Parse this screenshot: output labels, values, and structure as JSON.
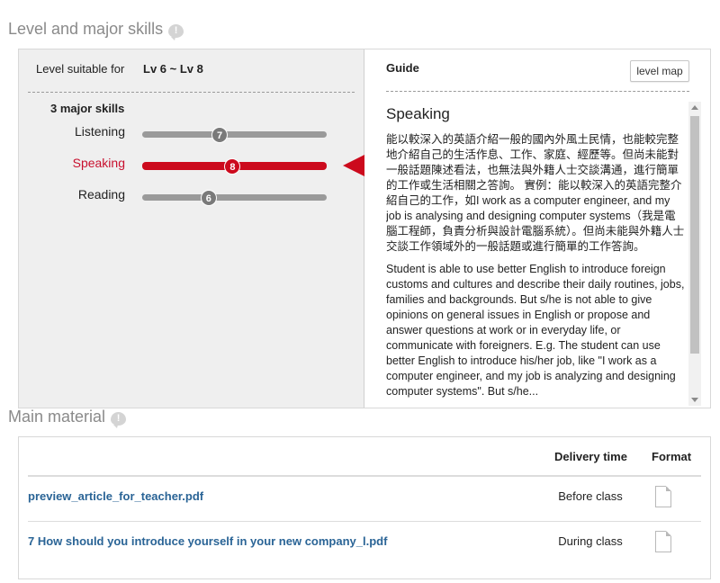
{
  "level_section": {
    "title": "Level and major skills",
    "help_icon": "!",
    "level_label": "Level suitable for",
    "level_value": "Lv 6 ~ Lv 8",
    "skills_title": "3 major skills",
    "skills": [
      {
        "label": "Listening",
        "level": "7",
        "fraction": 0.42,
        "active": false
      },
      {
        "label": "Speaking",
        "level": "8",
        "fraction": 0.49,
        "active": true
      },
      {
        "label": "Reading",
        "level": "6",
        "fraction": 0.36,
        "active": false
      }
    ],
    "accent_color": "#cc0a1d"
  },
  "guide": {
    "title": "Guide",
    "level_map_button": "level map",
    "heading": "Speaking",
    "paragraph_zh": "能以較深入的英語介紹一般的國內外風土民情，也能較完整地介紹自己的生活作息、工作、家庭、經歷等。但尚未能對一般話題陳述看法，也無法與外籍人士交談溝通，進行簡單的工作或生活相關之答詢。 實例：能以較深入的英語完整介紹自己的工作，如I work as a computer engineer, and my job is analysing and designing computer systems（我是電腦工程師，負責分析與設計電腦系統）。但尚未能與外籍人士交談工作領域外的一般話題或進行簡單的工作答詢。",
    "paragraph_en": "Student is able to use better English to introduce foreign customs and cultures and describe their daily routines, jobs, families and backgrounds. But s/he is not able to give opinions on general issues in English or propose and answer questions at work or in everyday life, or communicate with foreigners. E.g. The student can use better English to introduce his/her job, like \"I work as a computer engineer, and my job is analyzing and designing computer systems\". But s/he..."
  },
  "material_section": {
    "title": "Main material",
    "help_icon": "!",
    "columns": {
      "delivery": "Delivery time",
      "format": "Format"
    },
    "rows": [
      {
        "name": "preview_article_for_teacher.pdf",
        "delivery": "Before class",
        "format_icon": "document-icon"
      },
      {
        "name": "7 How should you introduce yourself in your new company_l.pdf",
        "delivery": "During class",
        "format_icon": "document-icon"
      }
    ],
    "link_color": "#2a6496"
  }
}
